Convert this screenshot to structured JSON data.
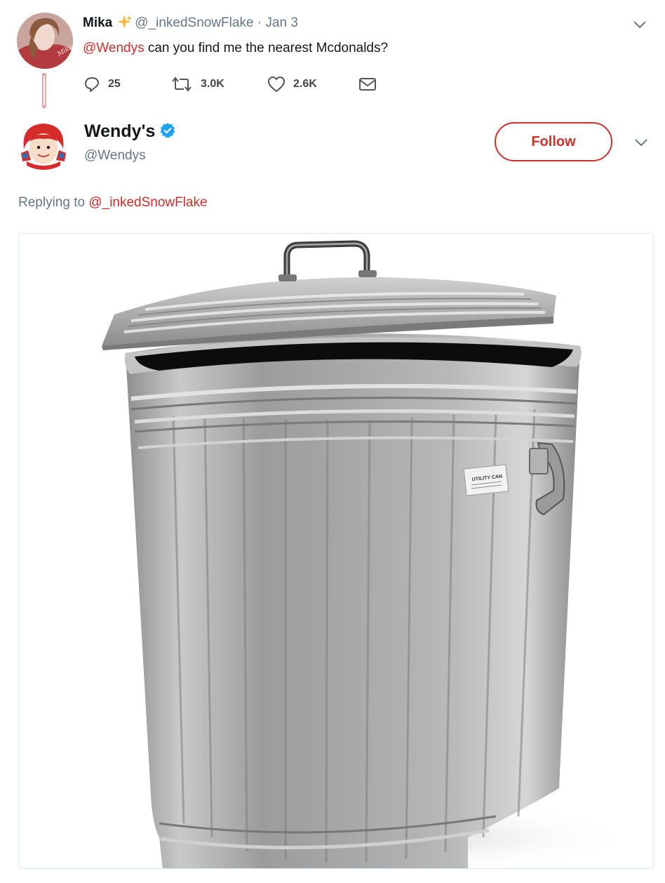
{
  "original_tweet": {
    "author_name": "Mika",
    "author_handle": "@_inkedSnowFlake",
    "separator": "·",
    "date": "Jan 3",
    "mention": "@Wendys",
    "text": " can you find me the nearest Mcdonalds?",
    "replies": "25",
    "retweets": "3.0K",
    "likes": "2.6K"
  },
  "reply": {
    "author_name": "Wendy's",
    "author_handle": "@Wendys",
    "follow_label": "Follow",
    "replying_prefix": "Replying to ",
    "replying_to": "@_inkedSnowFlake",
    "image_label": "UTILITY CAN"
  },
  "colors": {
    "brand_red": "#d0302c",
    "secondary_text": "#657786",
    "verified_blue": "#1da1f2"
  },
  "icons": [
    "sparkle-icon",
    "reply-icon",
    "retweet-icon",
    "like-icon",
    "dm-icon",
    "chevron-down-icon",
    "verified-icon"
  ]
}
